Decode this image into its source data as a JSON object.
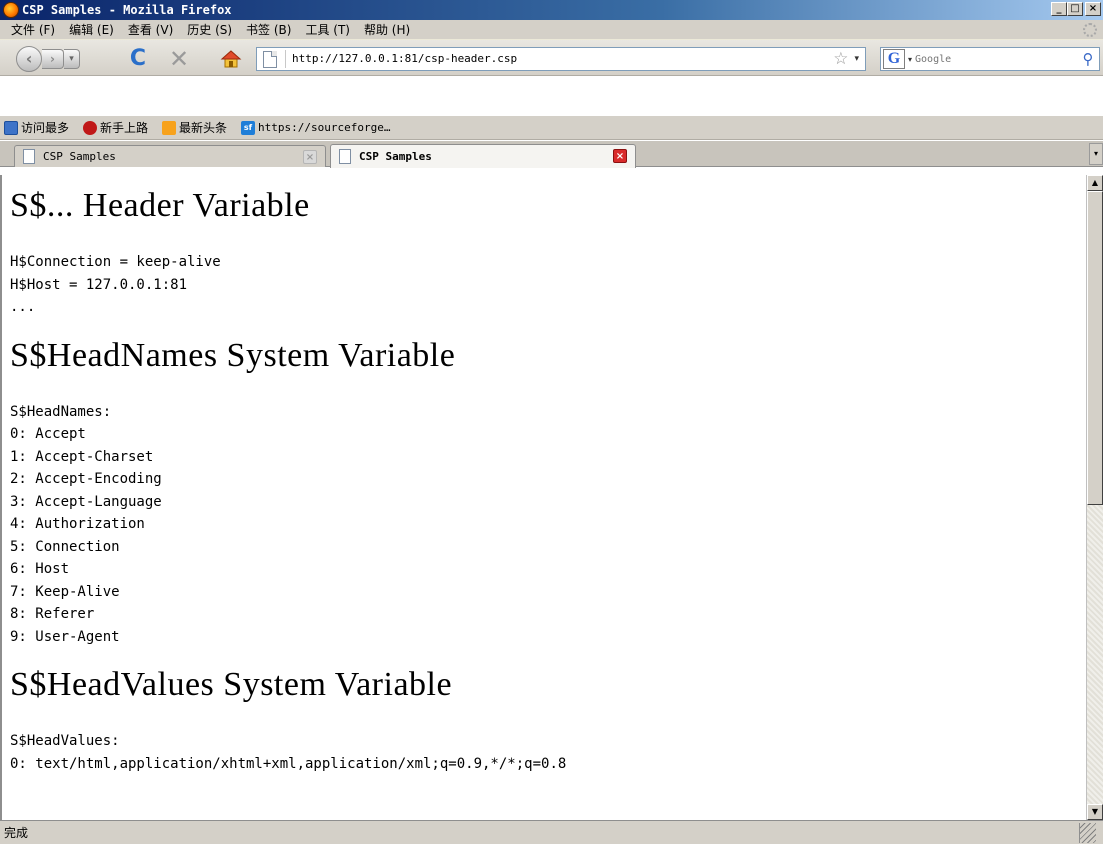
{
  "window": {
    "title": "CSP Samples - Mozilla Firefox",
    "controls": {
      "minimize": "_",
      "maximize": "□",
      "close": "×"
    }
  },
  "menu": [
    "文件 (F)",
    "编辑 (E)",
    "查看 (V)",
    "历史 (S)",
    "书签 (B)",
    "工具 (T)",
    "帮助 (H)"
  ],
  "nav": {
    "url": "http://127.0.0.1:81/csp-header.csp",
    "search_placeholder": "Google",
    "search_engine_letter": "G"
  },
  "bookmarks": [
    {
      "icon": "search-icon",
      "label": "访问最多"
    },
    {
      "icon": "bug-icon",
      "label": "新手上路"
    },
    {
      "icon": "rss-icon",
      "label": "最新头条"
    },
    {
      "icon": "sourceforge-icon",
      "label": "https://sourceforge…"
    }
  ],
  "tabs": [
    {
      "title": "CSP Samples",
      "active": false
    },
    {
      "title": "CSP Samples",
      "active": true
    }
  ],
  "content": {
    "sections": [
      {
        "heading": "S$... Header Variable",
        "lines": [
          "H$Connection = keep-alive",
          "H$Host = 127.0.0.1:81",
          "..."
        ]
      },
      {
        "heading": "S$HeadNames System Variable",
        "lines": [
          "S$HeadNames:",
          "0: Accept",
          "1: Accept-Charset",
          "2: Accept-Encoding",
          "3: Accept-Language",
          "4: Authorization",
          "5: Connection",
          "6: Host",
          "7: Keep-Alive",
          "8: Referer",
          "9: User-Agent"
        ]
      },
      {
        "heading": "S$HeadValues System Variable",
        "lines": [
          "S$HeadValues:",
          "0: text/html,application/xhtml+xml,application/xml;q=0.9,*/*;q=0.8"
        ]
      }
    ]
  },
  "status": {
    "text": "完成"
  },
  "colors": {
    "titlebar_start": "#0a246a",
    "titlebar_end": "#a6caf0",
    "chrome": "#d4d0c8",
    "tab_close_active": "#d92b2b",
    "reload_blue": "#2a6fc9"
  }
}
